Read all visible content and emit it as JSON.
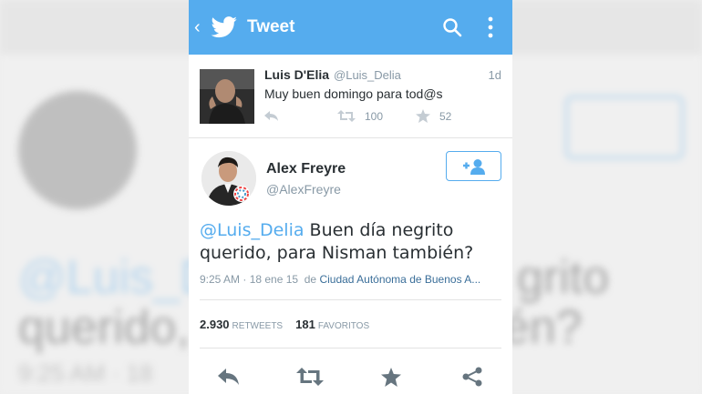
{
  "background": {
    "line1": "@Luis_De",
    "line1_tail": "grito",
    "line2": "querido,",
    "line2_tail": "mbién?",
    "line3": "9:25 AM · 18"
  },
  "appbar": {
    "back_icon": "chevron-left-icon",
    "logo_icon": "twitter-bird-icon",
    "title": "Tweet",
    "search_icon": "search-icon",
    "overflow_icon": "more-vertical-icon"
  },
  "parent_tweet": {
    "name": "Luis D'Elia",
    "handle": "@Luis_Delia",
    "time": "1d",
    "text": "Muy buen domingo para tod@s",
    "retweets": "100",
    "favorites": "52"
  },
  "tweet": {
    "name": "Alex Freyre",
    "handle": "@AlexFreyre",
    "mention": "@Luis_Delia",
    "text": " Buen día negrito querido, para Nisman también?",
    "time": "9:25 AM · 18 ene 15",
    "from_word": "de",
    "location": "Ciudad Autónoma de Buenos A...",
    "retweets_count": "2.930",
    "retweets_label": "RETWEETS",
    "favorites_count": "181",
    "favorites_label": "FAVORITOS"
  },
  "colors": {
    "brand": "#55acee",
    "text": "#292f33",
    "muted": "#8899a6",
    "icon": "#66757f"
  }
}
